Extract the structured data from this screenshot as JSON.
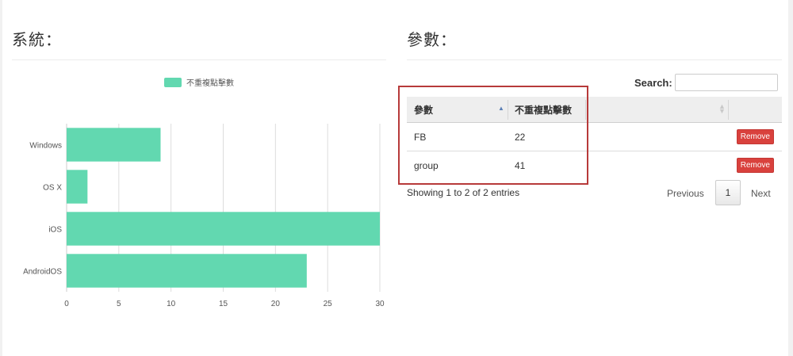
{
  "system_panel": {
    "title": "系統："
  },
  "params_panel": {
    "title": "參數：",
    "search": {
      "label": "Search:",
      "value": "",
      "placeholder": ""
    },
    "table": {
      "columns": [
        "參數",
        "不重複點擊數",
        "",
        ""
      ],
      "rows": [
        {
          "param": "FB",
          "count": "22",
          "action": "Remove"
        },
        {
          "param": "group",
          "count": "41",
          "action": "Remove"
        }
      ]
    },
    "info": "Showing 1 to 2 of 2 entries",
    "pagination": {
      "previous": "Previous",
      "current": "1",
      "next": "Next"
    }
  },
  "colors": {
    "bar": "#62d8b0",
    "grid": "#dddddd",
    "remove_button": "#d9413d",
    "highlight": "#b73a3a"
  },
  "chart_data": {
    "type": "bar",
    "orientation": "horizontal",
    "title": "",
    "xlabel": "",
    "ylabel": "",
    "categories": [
      "Windows",
      "OS X",
      "iOS",
      "AndroidOS"
    ],
    "series": [
      {
        "name": "不重複點擊數",
        "values": [
          9,
          2,
          30,
          23
        ]
      }
    ],
    "xlim": [
      0,
      30
    ],
    "xticks": [
      0,
      5,
      10,
      15,
      20,
      25,
      30
    ],
    "grid": true,
    "legend": "top-center"
  }
}
